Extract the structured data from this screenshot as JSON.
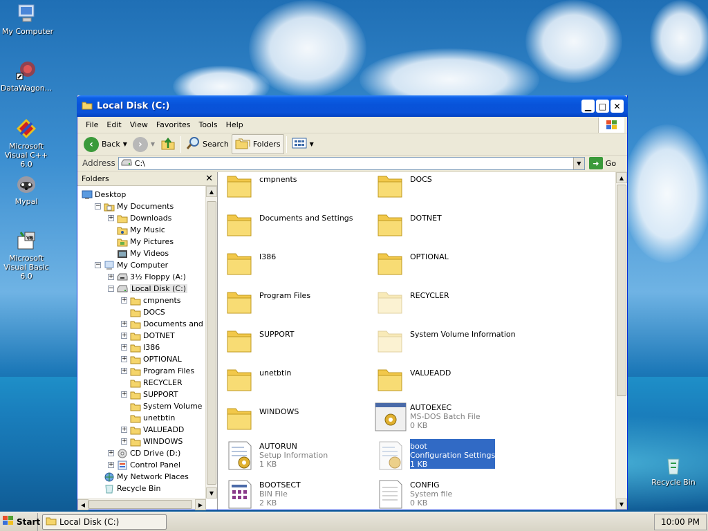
{
  "desktop": {
    "icons": [
      {
        "label": "My Computer"
      },
      {
        "label": "DataWagon..."
      },
      {
        "label": "Microsoft Visual C++ 6.0"
      },
      {
        "label": "Mypal"
      },
      {
        "label": "Microsoft Visual Basic 6.0"
      },
      {
        "label": "Recycle Bin"
      }
    ]
  },
  "window": {
    "title": "Local Disk (C:)",
    "menu": [
      "File",
      "Edit",
      "View",
      "Favorites",
      "Tools",
      "Help"
    ],
    "toolbar": {
      "back": "Back",
      "search": "Search",
      "folders": "Folders"
    },
    "address": {
      "label": "Address",
      "value": "C:\\",
      "go": "Go"
    },
    "folders_pane": {
      "title": "Folders",
      "close": "✕",
      "tree": [
        {
          "label": "Desktop",
          "toggle": ""
        },
        {
          "label": "My Documents",
          "toggle": "−"
        },
        {
          "label": "Downloads",
          "toggle": "+"
        },
        {
          "label": "My Music",
          "toggle": ""
        },
        {
          "label": "My Pictures",
          "toggle": ""
        },
        {
          "label": "My Videos",
          "toggle": ""
        },
        {
          "label": "My Computer",
          "toggle": "−"
        },
        {
          "label": "3½ Floppy (A:)",
          "toggle": "+"
        },
        {
          "label": "Local Disk (C:)",
          "toggle": "−"
        },
        {
          "label": "cmpnents",
          "toggle": "+"
        },
        {
          "label": "DOCS",
          "toggle": ""
        },
        {
          "label": "Documents and Setti",
          "toggle": "+"
        },
        {
          "label": "DOTNET",
          "toggle": "+"
        },
        {
          "label": "I386",
          "toggle": "+"
        },
        {
          "label": "OPTIONAL",
          "toggle": "+"
        },
        {
          "label": "Program Files",
          "toggle": "+"
        },
        {
          "label": "RECYCLER",
          "toggle": ""
        },
        {
          "label": "SUPPORT",
          "toggle": "+"
        },
        {
          "label": "System Volume Infor",
          "toggle": ""
        },
        {
          "label": "unetbtin",
          "toggle": ""
        },
        {
          "label": "VALUEADD",
          "toggle": "+"
        },
        {
          "label": "WINDOWS",
          "toggle": "+"
        },
        {
          "label": "CD Drive (D:)",
          "toggle": "+"
        },
        {
          "label": "Control Panel",
          "toggle": "+"
        },
        {
          "label": "My Network Places",
          "toggle": ""
        },
        {
          "label": "Recycle Bin",
          "toggle": ""
        }
      ]
    },
    "files": [
      {
        "name": "cmpnents",
        "type": "",
        "size": ""
      },
      {
        "name": "DOCS",
        "type": "",
        "size": ""
      },
      {
        "name": "Documents and Settings",
        "type": "",
        "size": ""
      },
      {
        "name": "DOTNET",
        "type": "",
        "size": ""
      },
      {
        "name": "I386",
        "type": "",
        "size": ""
      },
      {
        "name": "OPTIONAL",
        "type": "",
        "size": ""
      },
      {
        "name": "Program Files",
        "type": "",
        "size": ""
      },
      {
        "name": "RECYCLER",
        "type": "",
        "size": ""
      },
      {
        "name": "SUPPORT",
        "type": "",
        "size": ""
      },
      {
        "name": "System Volume Information",
        "type": "",
        "size": ""
      },
      {
        "name": "unetbtin",
        "type": "",
        "size": ""
      },
      {
        "name": "VALUEADD",
        "type": "",
        "size": ""
      },
      {
        "name": "WINDOWS",
        "type": "",
        "size": ""
      },
      {
        "name": "AUTOEXEC",
        "type": "MS-DOS Batch File",
        "size": "0 KB"
      },
      {
        "name": "AUTORUN",
        "type": "Setup Information",
        "size": "1 KB"
      },
      {
        "name": "boot",
        "type": "Configuration Settings",
        "size": "1 KB"
      },
      {
        "name": "BOOTSECT",
        "type": "BIN File",
        "size": "2 KB"
      },
      {
        "name": "CONFIG",
        "type": "System file",
        "size": "0 KB"
      }
    ]
  },
  "taskbar": {
    "start": "Start",
    "task": "Local Disk (C:)",
    "clock": "10:00 PM"
  }
}
